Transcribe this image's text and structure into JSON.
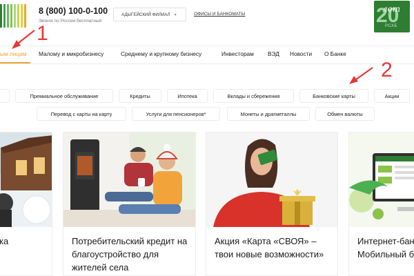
{
  "header": {
    "phone": "8 (800) 100-0-100",
    "phone_note": "Звонок по России бесплатный",
    "branch": "АДЫГЕЙСКИЙ ФИЛИАЛ",
    "offices_link": "ОФИСЫ И БАНКОМАТЫ",
    "anniversary": {
      "number": "20",
      "word": "лет",
      "abbr": "РСХБ"
    }
  },
  "nav": {
    "items": [
      {
        "label": "ым лицам",
        "active": true
      },
      {
        "label": "Малому и микробизнесу"
      },
      {
        "label": "Среднему и крупному бизнесу"
      },
      {
        "label": "Инвесторам"
      },
      {
        "label": "ВЭД"
      },
      {
        "label": "Новости"
      },
      {
        "label": "О Банке"
      }
    ]
  },
  "chips": {
    "row1": [
      "Премиальное обслуживание",
      "Кредиты",
      "Ипотека",
      "Вклады и сбережения",
      "Банковские карты",
      "Акции"
    ],
    "row2": [
      "Перевод с карты на карту",
      "Услуги для пенсионеров*",
      "Монеты и драгметаллы",
      "Обмен валюты"
    ]
  },
  "annotations": {
    "one": "1",
    "two": "2"
  },
  "cards": [
    {
      "title": "ка"
    },
    {
      "title": "Потребительский кредит на благоустройство для жителей села"
    },
    {
      "title": "Акция «Карта «СВОЯ» – твои новые возможности»"
    },
    {
      "title": "Интернет-бан Мобильный б"
    }
  ],
  "colors": {
    "accent": "#f0a42f",
    "brand_green": "#2e7d33",
    "annotation_red": "#e53935",
    "logo_stripes": [
      "#2e7d33",
      "#4caf50",
      "#8bc34a",
      "#cddc39",
      "#f0a42f"
    ]
  }
}
